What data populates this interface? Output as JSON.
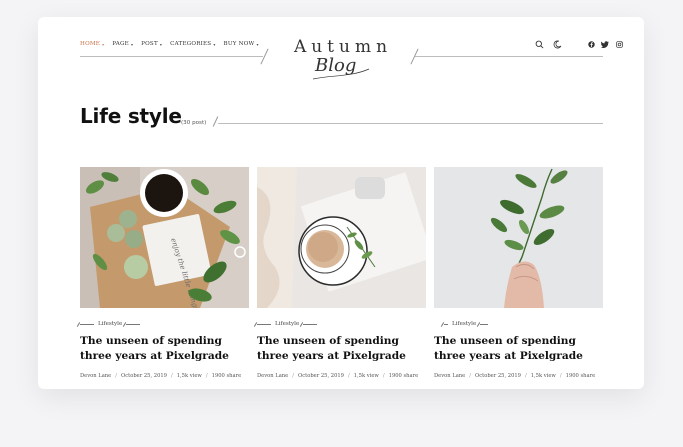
{
  "nav": {
    "items": [
      {
        "label": "HOME",
        "active": true
      },
      {
        "label": "PAGE",
        "active": false
      },
      {
        "label": "POST",
        "active": false
      },
      {
        "label": "CATEGORIES",
        "active": false
      },
      {
        "label": "BUY NOW",
        "active": false
      }
    ]
  },
  "logo": {
    "top": "Autumn",
    "script": "Blog"
  },
  "icons": {
    "search": "search-icon",
    "dark_mode": "moon-icon",
    "facebook": "facebook-icon",
    "twitter": "twitter-icon",
    "instagram": "instagram-icon"
  },
  "page": {
    "title": "Life style",
    "count": "(30 post)"
  },
  "posts": [
    {
      "category": "Lifestyle",
      "title": "The unseen of spending three years at Pixelgrade",
      "author": "Devon Lane",
      "date": "October 25, 2019",
      "views": "1,5k view",
      "shares": "1900 share"
    },
    {
      "category": "Lifestyle",
      "title": "The unseen of spending three years at Pixelgrade",
      "author": "Devon Lane",
      "date": "October 25, 2019",
      "views": "1,5k view",
      "shares": "1900 share"
    },
    {
      "category": "Lifestyle",
      "title": "The unseen of spending three years at Pixelgrade",
      "author": "Devon Lane",
      "date": "October 25, 2019",
      "views": "1,5k view",
      "shares": "1900 share"
    }
  ],
  "colors": {
    "accent": "#c76a3f",
    "background": "#f4f4f6",
    "card": "#ffffff"
  }
}
